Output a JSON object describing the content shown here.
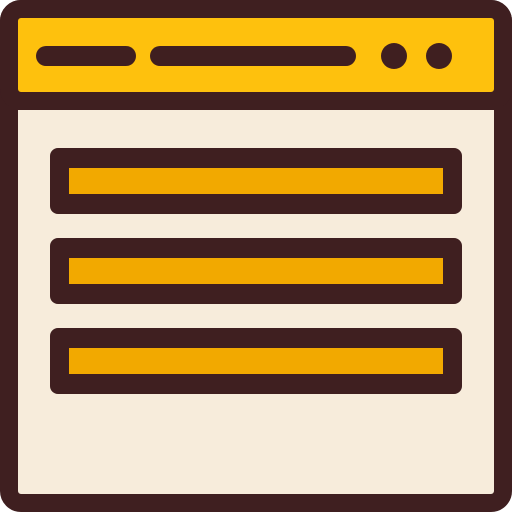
{
  "icon": {
    "name": "browser-window-list-icon",
    "colors": {
      "outline": "#3f1f20",
      "titlebar": "#fec10d",
      "window_body": "#f7ecdb",
      "list_bar": "#f2a900"
    },
    "titlebar_elements": [
      "address-bar-short",
      "address-bar-long",
      "window-dot",
      "window-dot"
    ],
    "list_rows": [
      "list-row",
      "list-row",
      "list-row"
    ]
  }
}
